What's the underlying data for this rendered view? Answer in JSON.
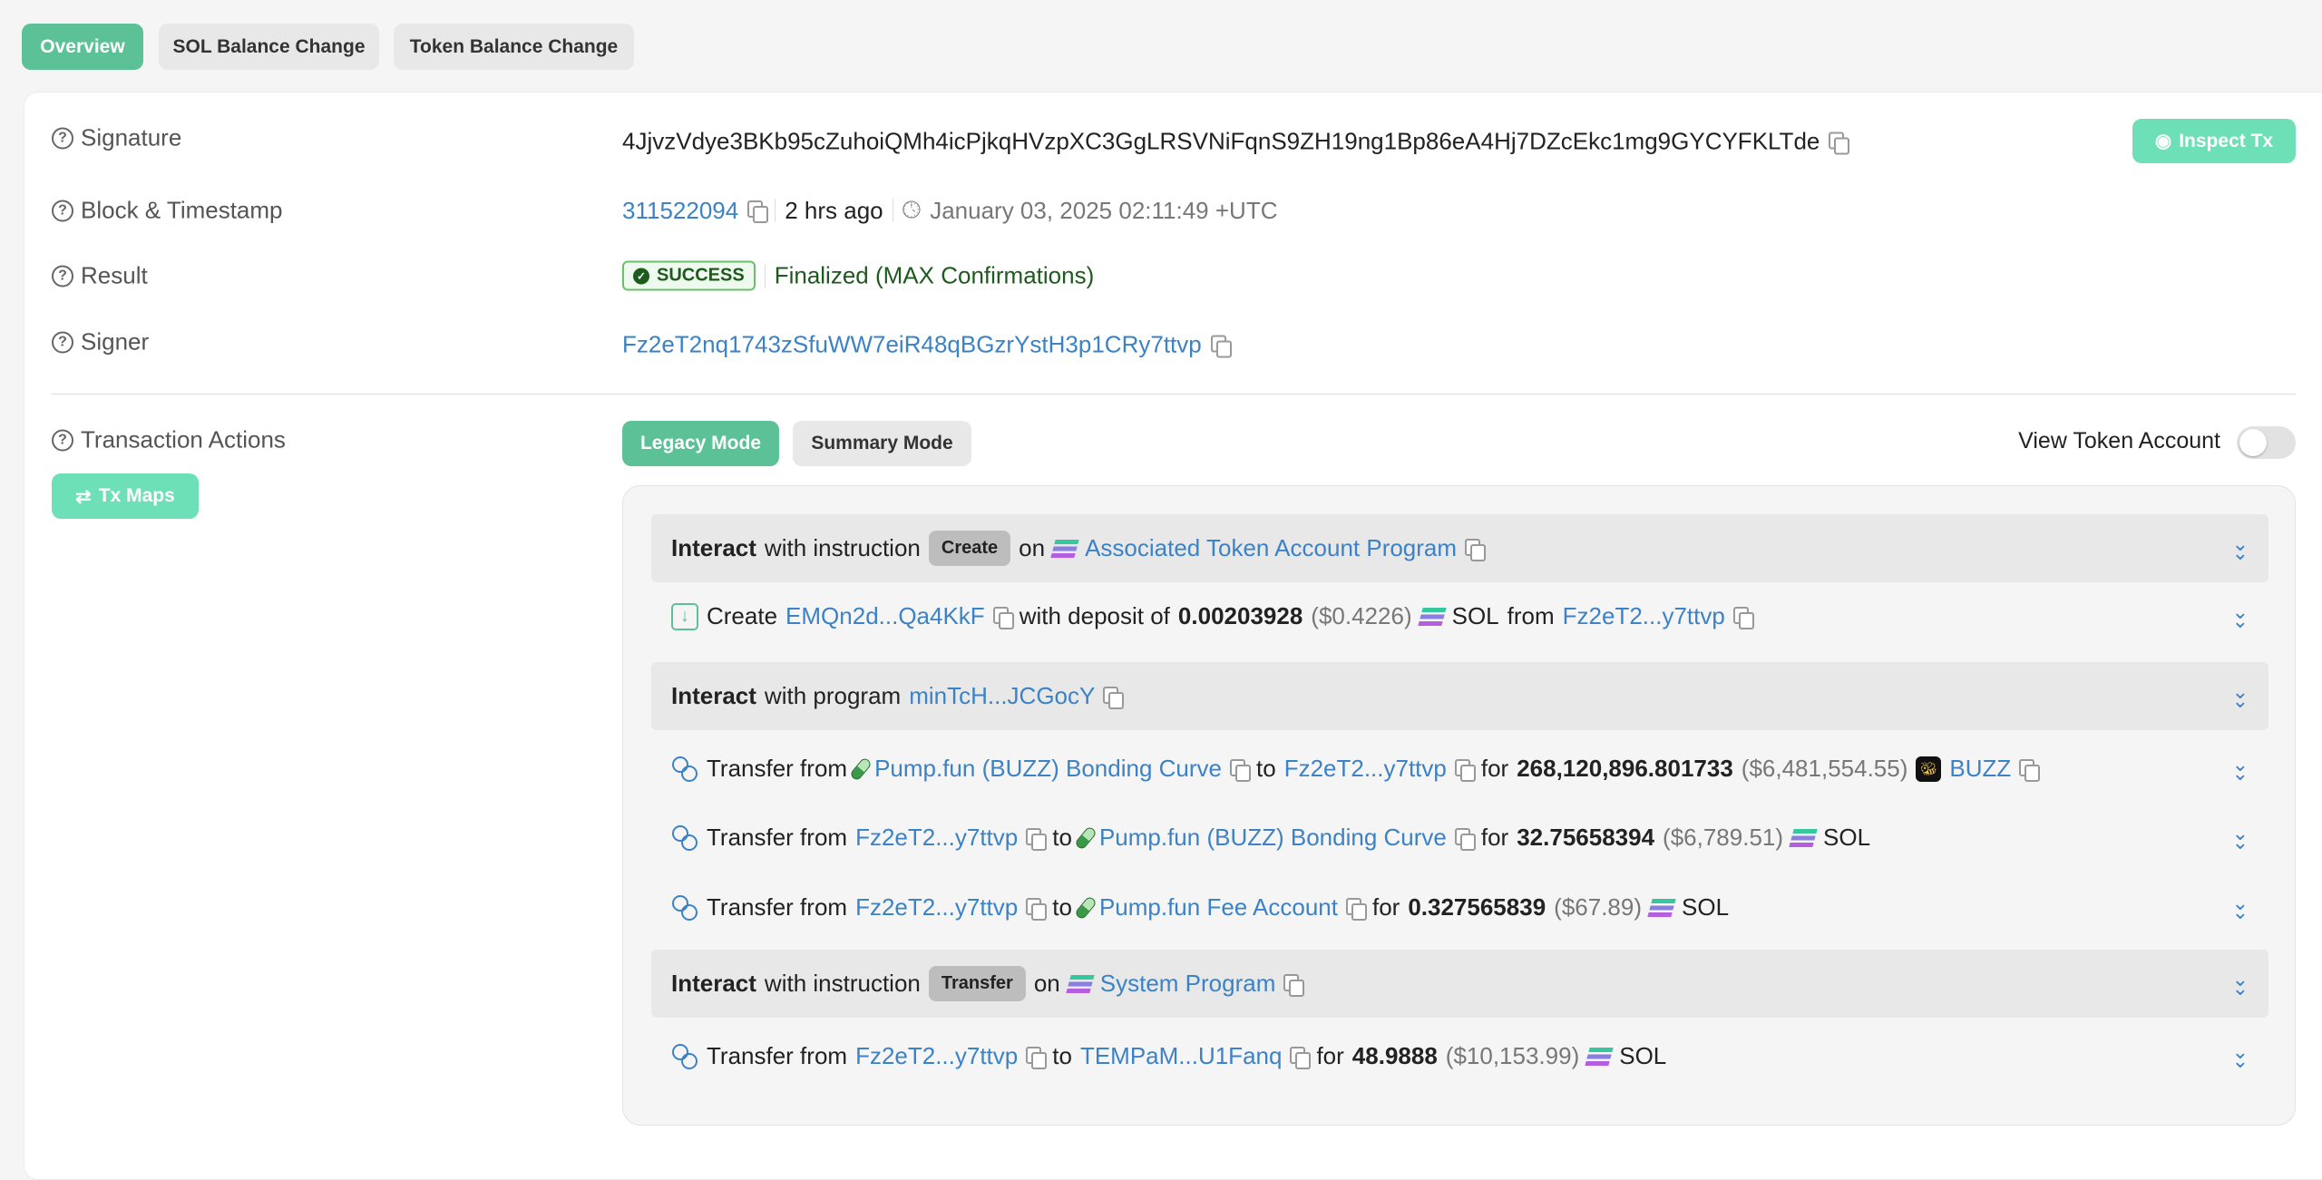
{
  "tabs": [
    "Overview",
    "SOL Balance Change",
    "Token Balance Change"
  ],
  "overview": {
    "signature_label": "Signature",
    "signature": "4JjvzVdye3BKb95cZuhoiQMh4icPjkqHVzpXC3GgLRSVNiFqnS9ZH19ng1Bp86eA4Hj7DZcEkc1mg9GYCYFKLTde",
    "inspect_label": "Inspect Tx",
    "block_label": "Block & Timestamp",
    "block": "311522094",
    "ago": "2 hrs ago",
    "timestamp": "January 03, 2025 02:11:49 +UTC",
    "result_label": "Result",
    "result_badge": "SUCCESS",
    "result_text": "Finalized (MAX Confirmations)",
    "signer_label": "Signer",
    "signer": "Fz2eT2nq1743zSfuWW7eiR48qBGzrYstH3p1CRy7ttvp",
    "actions_label": "Transaction Actions",
    "tx_maps": "Tx Maps",
    "legacy_mode": "Legacy Mode",
    "summary_mode": "Summary Mode",
    "view_token_account": "View Token Account"
  },
  "words": {
    "interact": "Interact",
    "with_instruction": "with instruction",
    "with_program": "with program",
    "on": "on",
    "create": "Create",
    "with_deposit": "with deposit of",
    "from": "from",
    "transfer_from": "Transfer from",
    "to": "to",
    "for": "for",
    "sol": "SOL"
  },
  "actions": {
    "h1": {
      "instruction": "Create",
      "program": "Associated Token Account Program"
    },
    "a1": {
      "account": "EMQn2d...Qa4KkF",
      "amount": "0.00203928",
      "usd": "($0.4226)",
      "from": "Fz2eT2...y7ttvp"
    },
    "h2": {
      "program": "minTcH...JCGocY"
    },
    "t1": {
      "from": "Pump.fun (BUZZ) Bonding Curve",
      "to": "Fz2eT2...y7ttvp",
      "amount": "268,120,896.801733",
      "usd": "($6,481,554.55)",
      "token": "BUZZ"
    },
    "t2": {
      "from": "Fz2eT2...y7ttvp",
      "to": "Pump.fun (BUZZ) Bonding Curve",
      "amount": "32.75658394",
      "usd": "($6,789.51)"
    },
    "t3": {
      "from": "Fz2eT2...y7ttvp",
      "to": "Pump.fun Fee Account",
      "amount": "0.327565839",
      "usd": "($67.89)"
    },
    "h3": {
      "instruction": "Transfer",
      "program": "System Program"
    },
    "t4": {
      "from": "Fz2eT2...y7ttvp",
      "to": "TEMPaM...U1Fanq",
      "amount": "48.9888",
      "usd": "($10,153.99)"
    }
  }
}
